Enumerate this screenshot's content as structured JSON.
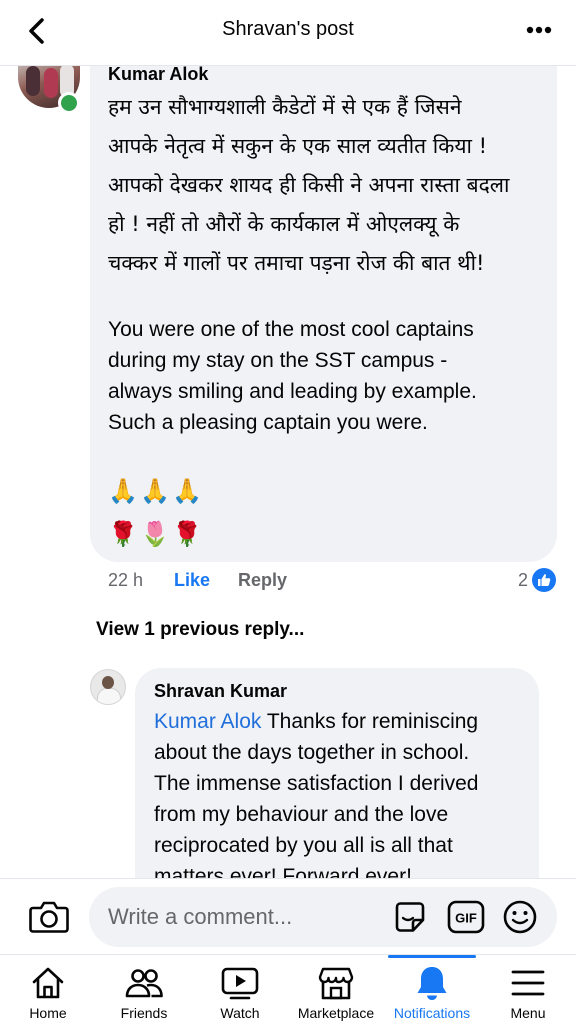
{
  "header": {
    "title": "Shravan's post",
    "back_icon": "chevron-left-icon",
    "more_icon": "more-horizontal-icon"
  },
  "comment": {
    "author": "Kumar Alok",
    "hindi_lines": [
      "हम उन सौभाग्यशाली कैडेटों में से एक हैं जिसने",
      "आपके नेतृत्व में सकुन के एक साल व्यतीत किया !",
      "आपको देखकर शायद ही किसी ने अपना रास्ता बदला",
      "हो ! नहीं तो औरों के कार्यकाल में ओएलक्यू के",
      "चक्कर में गालों पर तमाचा पड़ना रोज की बात थी!"
    ],
    "english_lines": [
      "You were one of the most cool captains",
      "during my stay on the SST campus -",
      "always smiling and leading by example.",
      "Such a pleasing captain you were."
    ],
    "emoji_row_1": [
      "🙏",
      "🙏",
      "🙏"
    ],
    "emoji_row_2": [
      "🌹",
      "🌷",
      "🌹"
    ],
    "time": "22 h",
    "like_label": "Like",
    "reply_label": "Reply",
    "reaction_count": "2",
    "online": true
  },
  "view_previous": "View 1 previous reply...",
  "reply": {
    "author": "Shravan Kumar",
    "mention": "Kumar Alok",
    "text_lines": [
      " Thanks for reminiscing",
      "about the days together in school.",
      "The immense satisfaction I derived",
      "from my behaviour and the love",
      "reciprocated by you all is all that",
      "matters ever! Forward ever!"
    ]
  },
  "composer": {
    "placeholder": "Write a comment...",
    "camera_icon": "camera-icon",
    "sticker_icon": "sticker-icon",
    "gif_label": "GIF",
    "emoji_icon": "smiley-icon"
  },
  "tabs": [
    {
      "label": "Home",
      "icon": "home-icon",
      "active": false
    },
    {
      "label": "Friends",
      "icon": "friends-icon",
      "active": false
    },
    {
      "label": "Watch",
      "icon": "watch-icon",
      "active": false
    },
    {
      "label": "Marketplace",
      "icon": "marketplace-icon",
      "active": false
    },
    {
      "label": "Notifications",
      "icon": "bell-icon",
      "active": true
    },
    {
      "label": "Menu",
      "icon": "menu-icon",
      "active": false
    }
  ],
  "colors": {
    "accent": "#1877f2",
    "bubble": "#f0f2f5",
    "online": "#31a24c",
    "mention": "#216fdb",
    "secondary_text": "#65676b"
  }
}
